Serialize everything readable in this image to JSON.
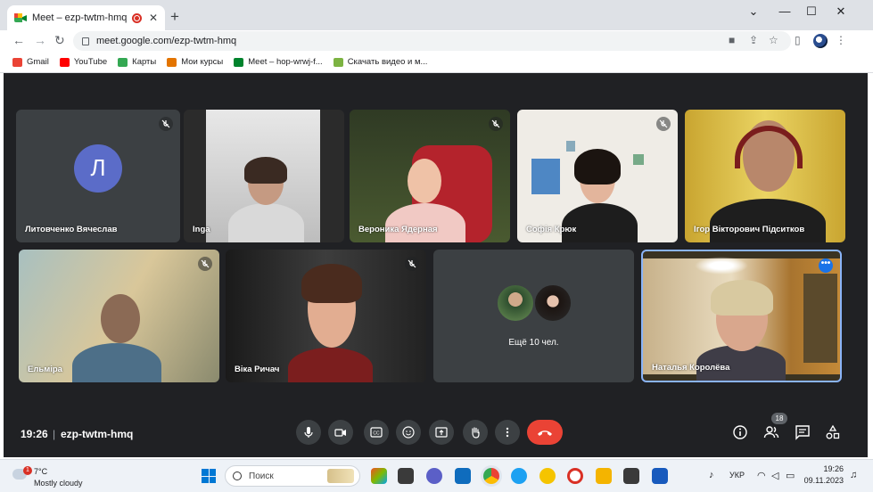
{
  "browser": {
    "tab_title": "Meet – ezp-twtm-hmq",
    "tab_close": "✕",
    "new_tab": "+",
    "url": "meet.google.com/ezp-twtm-hmq",
    "window_controls": [
      "⌄",
      "—",
      "☐",
      "✕"
    ]
  },
  "bookmarks": [
    {
      "label": "Gmail",
      "color": "#ea4335"
    },
    {
      "label": "YouTube",
      "color": "#ff0000"
    },
    {
      "label": "Карты",
      "color": "#34a853"
    },
    {
      "label": "Мои курсы",
      "color": "#e37400"
    },
    {
      "label": "Meet – hop-wrwj-f...",
      "color": "#00832d"
    },
    {
      "label": "Скачать видео и м...",
      "color": "#7cb342"
    }
  ],
  "participants": [
    {
      "name": "Литовченко Вячеслав",
      "initial": "Л",
      "muted": true
    },
    {
      "name": "Inga",
      "muted": false
    },
    {
      "name": "Вероника Ядерная",
      "muted": true
    },
    {
      "name": "Софія Крюк",
      "muted": true
    },
    {
      "name": "Ігор Вікторович Підситков",
      "muted": false
    },
    {
      "name": "Ельміра",
      "muted": true
    },
    {
      "name": "Віка Ричач",
      "muted": true
    },
    {
      "name": "Наталья Королёва",
      "muted": false,
      "pinned": true
    }
  ],
  "more_tile": {
    "label": "Ещё 10 чел."
  },
  "meeting": {
    "time": "19:26",
    "separator": "|",
    "code": "ezp-twtm-hmq",
    "people_count": "18",
    "options_dots": "•••"
  },
  "taskbar": {
    "weather_temp": "7°C",
    "weather_desc": "Mostly cloudy",
    "weather_badge": "1",
    "search_placeholder": "Поиск",
    "language": "УКР",
    "time": "19:26",
    "date": "09.11.2023"
  }
}
